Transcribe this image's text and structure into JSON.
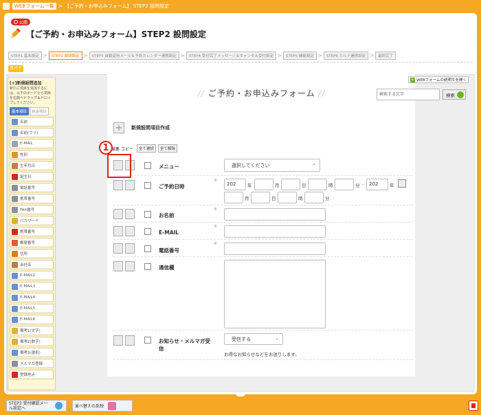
{
  "topbar": {
    "crumbs": [
      "WEBフォーム一覧",
      "【ご予約・お申込みフォーム】 STEP2 設問設定"
    ]
  },
  "badge": "公開",
  "page_title": "【ご予約・お申込みフォーム】STEP2 設問設定",
  "steps": [
    {
      "label": "STEP1 基本設定",
      "active": false
    },
    {
      "label": "STEP2 設問設定",
      "active": true
    },
    {
      "label": "STEP3 自動返信メール＆予約カレンダー連携設定",
      "active": false
    },
    {
      "label": "STEP4 受付完了メッセージ＆キャンセル受付設定",
      "active": false
    },
    {
      "label": "STEP5 機能設定",
      "active": false
    },
    {
      "label": "STEP6 カルテ連携設定",
      "active": false
    },
    {
      "label": "最終完了",
      "active": false
    }
  ],
  "guide": "ガイド",
  "sidebar": {
    "heading": "[+]新規設問追加",
    "desc": "新たに項目を追加するには、以下のボードから項目を右側へドラッグ＆ドロップしてください。",
    "tabs": [
      "基本項目",
      "自由項目"
    ],
    "items": [
      "名前",
      "名前(フリ)",
      "E-MAIL",
      "性別",
      "生年月日",
      "誕生日",
      "電話番号",
      "携帯番号",
      "FAX番号",
      "パスワード",
      "携帯番号",
      "郵便番号",
      "住所",
      "会社名",
      "E-MAIL2",
      "E-MAIL3",
      "E-MAIL4",
      "E-MAIL5",
      "E-MAIL6",
      "備考1(文字)",
      "備考2(数字)",
      "備考3(選択)",
      "メルマガ登録",
      "登録地点"
    ],
    "colors": [
      "#6b8fd0",
      "#6b8fd0",
      "#9aa4b8",
      "#e0952a",
      "#d07a3a",
      "#d9261c",
      "#8c9099",
      "#8c9099",
      "#8c9099",
      "#e0b030",
      "#d9261c",
      "#e05a30",
      "#e07b00",
      "#b08050",
      "#6b8fd0",
      "#6b8fd0",
      "#6b8fd0",
      "#6b8fd0",
      "#6b8fd0",
      "#e0b030",
      "#e0b030",
      "#6b8fd0",
      "#8c9099",
      "#d9261c"
    ]
  },
  "form": {
    "title": "ご予約・お申込みフォーム",
    "desc_button": "WEBフォームの説明文を開く",
    "search_placeholder": "検索する文字",
    "search_button": "検索",
    "new_item": "新規設問項目作成",
    "header": {
      "edit": "編集",
      "copy": "コピー",
      "select_all": "全て選択",
      "clear_all": "全て解除"
    },
    "annotation": "1",
    "rows": {
      "menu": {
        "label": "メニュー",
        "select": "選択してください"
      },
      "date": {
        "label": "ご予約日時",
        "req": "※",
        "y1": "202",
        "u_year": "年",
        "u_month": "月",
        "u_day": "日",
        "u_hour": "時",
        "u_min": "分",
        "dash": "-",
        "y2": "202",
        "u_year2": "年",
        "u_month2": "月",
        "u_day2": "日",
        "u_hour2": "時",
        "u_min2": "分"
      },
      "name": {
        "label": "お名前",
        "req": "※"
      },
      "email": {
        "label": "E-MAIL",
        "req": "※"
      },
      "phone": {
        "label": "電話番号",
        "req": "※"
      },
      "message": {
        "label": "通信欄"
      },
      "newsletter": {
        "label": "お知らせ・メルマガ受信",
        "select": "受信する",
        "note": "お得なお知らせなどをお送りします。"
      }
    }
  },
  "footer": {
    "step3": "STEP3 受付確認メール設定へ",
    "reorder": "並べ替えの反映"
  }
}
